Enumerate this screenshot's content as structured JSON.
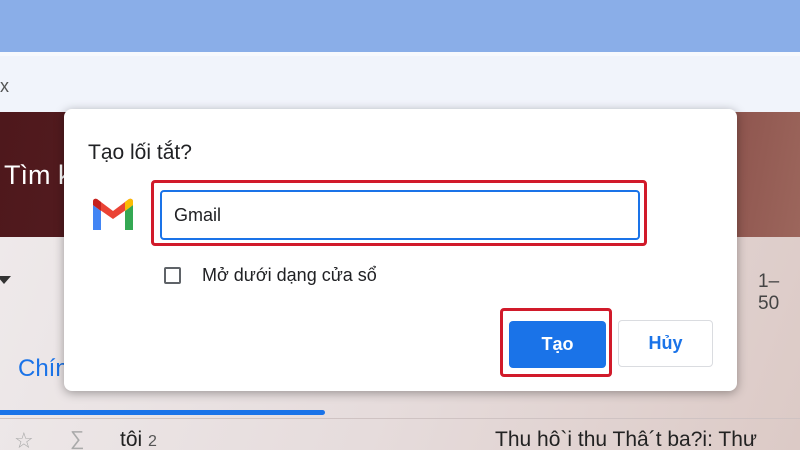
{
  "browser": {
    "address_fragment": "x"
  },
  "background": {
    "search_text": "Tìm k",
    "count_text": "1–50",
    "tab_label": "Chín",
    "row": {
      "sender": "tôi",
      "sender_count": "2",
      "subject": "Thu hô`i thu Thâ´t ba?i: Thư"
    }
  },
  "dialog": {
    "title": "Tạo lối tắt?",
    "name_input_value": "Gmail",
    "checkbox_label": "Mở dưới dạng cửa sổ",
    "checkbox_checked": false,
    "create_label": "Tạo",
    "cancel_label": "Hủy"
  },
  "colors": {
    "accent": "#1a73e8",
    "highlight": "#d11a2a"
  },
  "icons": {
    "app_logo": "gmail-icon",
    "star": "star-icon",
    "snooze": "label-icon"
  }
}
